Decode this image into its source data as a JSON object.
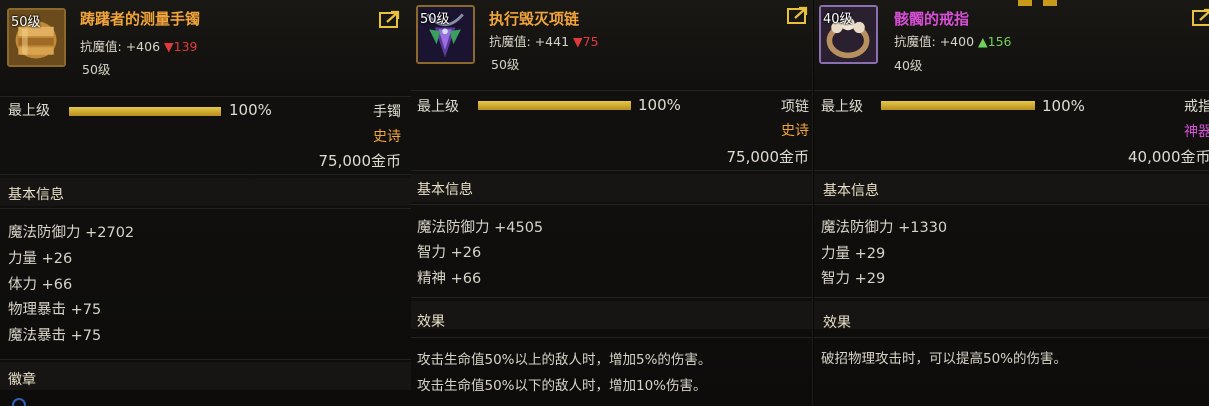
{
  "items": [
    {
      "icon": "bracelet-icon",
      "level_tag": "50级",
      "name": "踌躇者的测量手镯",
      "stat_label": "抗魔值:",
      "stat_value": "+406",
      "delta_dir": "down",
      "delta_arrow": "▼",
      "delta_value": "139",
      "level": "50级",
      "grade_label": "最上级",
      "grade_pct_value": 100,
      "grade_pct": "100%",
      "type": "手镯",
      "rarity": "史诗",
      "price": "75,000金币",
      "basic_title": "基本信息",
      "attrs": [
        "魔法防御力 +2702",
        "力量 +26",
        "体力 +66",
        "物理暴击 +75",
        "魔法暴击 +75"
      ],
      "extra_title": "徽章"
    },
    {
      "icon": "necklace-icon",
      "level_tag": "50级",
      "name": "执行毁灭项链",
      "stat_label": "抗魔值:",
      "stat_value": "+441",
      "delta_dir": "down",
      "delta_arrow": "▼",
      "delta_value": "75",
      "level": "50级",
      "grade_label": "最上级",
      "grade_pct_value": 100,
      "grade_pct": "100%",
      "type": "项链",
      "rarity": "史诗",
      "price": "75,000金币",
      "basic_title": "基本信息",
      "attrs": [
        "魔法防御力 +4505",
        "智力 +26",
        "精神 +66"
      ],
      "effect_title": "效果",
      "effects": [
        "攻击生命值50%以上的敌人时，增加5%的伤害。",
        "攻击生命值50%以下的敌人时，增加10%伤害。"
      ]
    },
    {
      "icon": "ring-icon",
      "level_tag": "40级",
      "name": "骸髑的戒指",
      "stat_label": "抗魔值:",
      "stat_value": "+400",
      "delta_dir": "up",
      "delta_arrow": "▲",
      "delta_value": "156",
      "level": "40级",
      "grade_label": "最上级",
      "grade_pct_value": 100,
      "grade_pct": "100%",
      "type": "戒指",
      "rarity": "神器",
      "price": "40,000金币",
      "basic_title": "基本信息",
      "attrs": [
        "魔法防御力 +1330",
        "力量 +29",
        "智力 +29"
      ],
      "effect_title": "效果",
      "effects": [
        "破招物理攻击时，可以提高50%的伤害。"
      ]
    }
  ],
  "colors": {
    "epic": "#f0a43a",
    "myth": "#d64fd6",
    "down": "#e0393a",
    "up": "#6fd05a",
    "bar": "#e6c84a"
  }
}
